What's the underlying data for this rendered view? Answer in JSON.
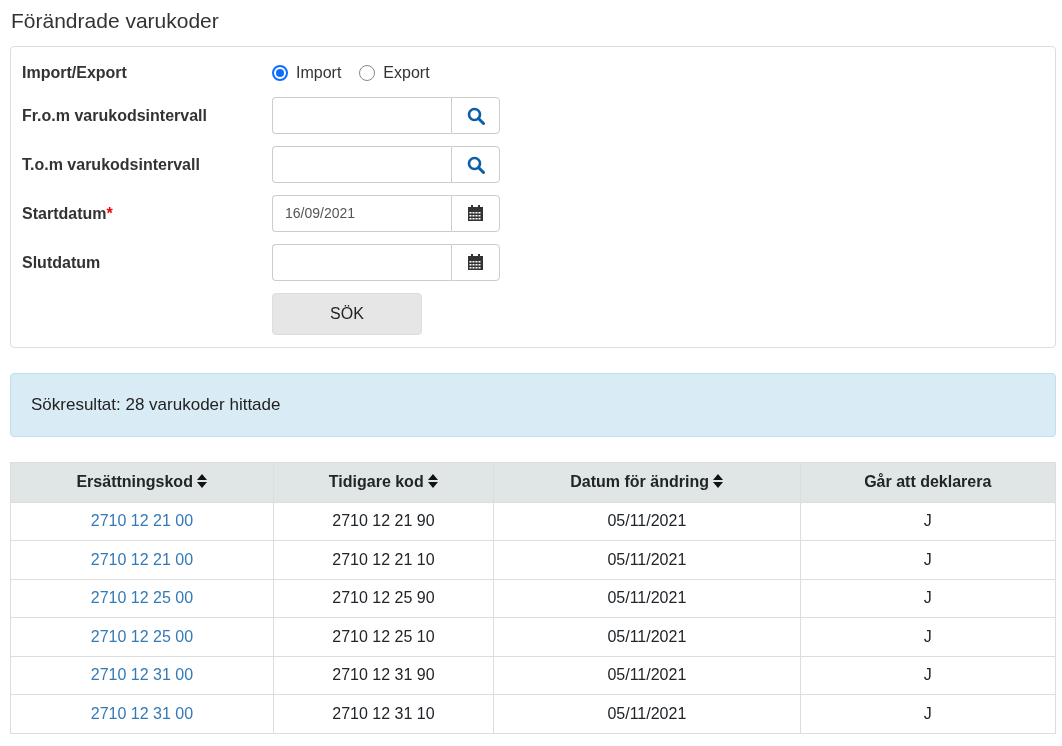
{
  "page_title": "Förändrade varukoder",
  "form": {
    "fields": [
      {
        "kind": "radio",
        "label": "Import/Export",
        "options": [
          {
            "label": "Import",
            "selected": true
          },
          {
            "label": "Export",
            "selected": false
          }
        ]
      },
      {
        "kind": "search",
        "label": "Fr.o.m varukodsintervall"
      },
      {
        "kind": "search",
        "label": "T.o.m varukodsintervall"
      },
      {
        "kind": "date",
        "label": "Startdatum",
        "required_marker": "*",
        "value": "16/09/2021"
      },
      {
        "kind": "date",
        "label": "Slutdatum"
      }
    ],
    "submit_button": "SÖK"
  },
  "result_alert": "Sökresultat: 28 varukoder hittade",
  "table": {
    "columns": [
      {
        "label": "Ersättningskod",
        "sortable": true
      },
      {
        "label": "Tidigare kod",
        "sortable": true
      },
      {
        "label": "Datum för ändring",
        "sortable": true
      },
      {
        "label": "Går att deklarera",
        "sortable": false
      }
    ],
    "rows": [
      [
        "2710 12 21 00",
        "2710 12 21 90",
        "05/11/2021",
        "J"
      ],
      [
        "2710 12 21 00",
        "2710 12 21 10",
        "05/11/2021",
        "J"
      ],
      [
        "2710 12 25 00",
        "2710 12 25 90",
        "05/11/2021",
        "J"
      ],
      [
        "2710 12 25 00",
        "2710 12 25 10",
        "05/11/2021",
        "J"
      ],
      [
        "2710 12 31 00",
        "2710 12 31 90",
        "05/11/2021",
        "J"
      ],
      [
        "2710 12 31 00",
        "2710 12 31 10",
        "05/11/2021",
        "J"
      ]
    ]
  }
}
